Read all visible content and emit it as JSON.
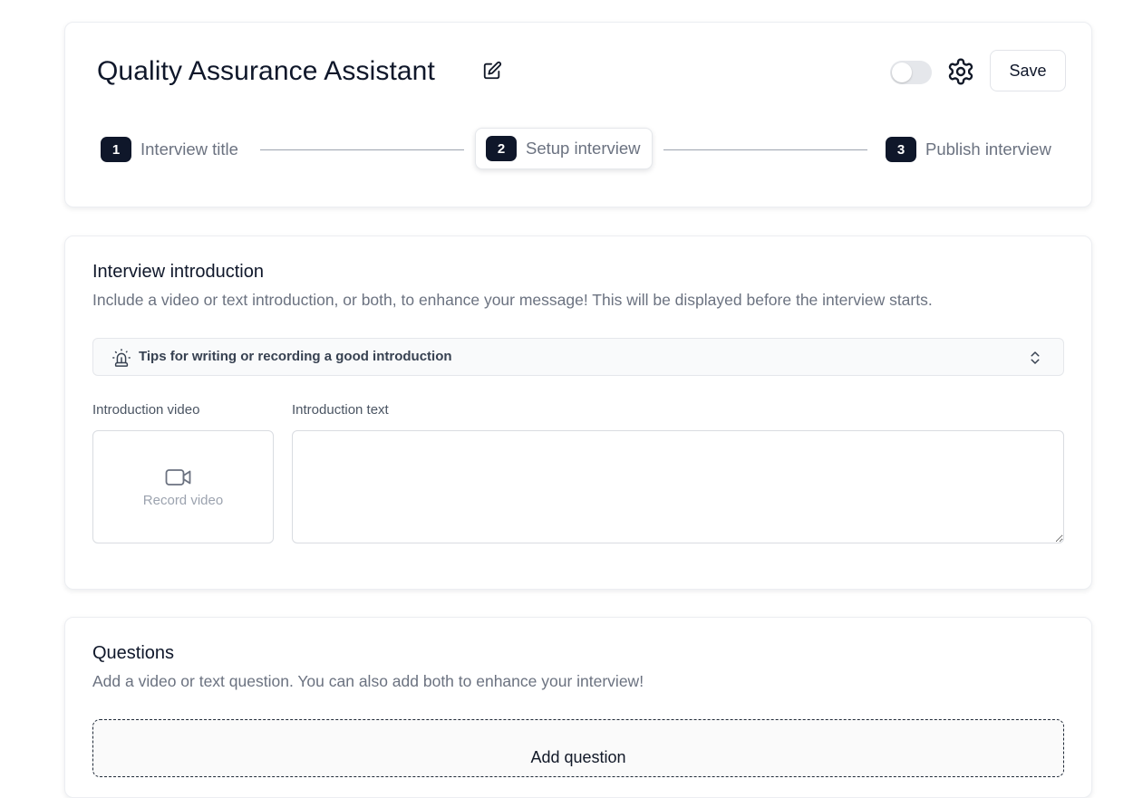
{
  "header": {
    "title": "Quality Assurance Assistant",
    "save_label": "Save",
    "toggle_on": false
  },
  "steps": [
    {
      "number": "1",
      "label": "Interview title",
      "active": false
    },
    {
      "number": "2",
      "label": "Setup interview",
      "active": true
    },
    {
      "number": "3",
      "label": "Publish interview",
      "active": false
    }
  ],
  "intro": {
    "title": "Interview introduction",
    "description": "Include a video or text introduction, or both, to enhance your message! This will be displayed before the interview starts.",
    "tips_label": "Tips for writing or recording a good introduction",
    "video_label": "Introduction video",
    "record_label": "Record video",
    "text_label": "Introduction text",
    "text_value": ""
  },
  "questions": {
    "title": "Questions",
    "description": "Add a video or text question. You can also add both to enhance your interview!",
    "add_label": "Add question"
  },
  "icons": {
    "edit": "edit-icon",
    "gear": "gear-icon",
    "siren": "siren-icon",
    "chevrons": "chevrons-up-down-icon",
    "camera": "video-camera-icon"
  },
  "colors": {
    "accent": "#0f172a",
    "muted_text": "#6b7280",
    "border": "#e5e7eb"
  }
}
